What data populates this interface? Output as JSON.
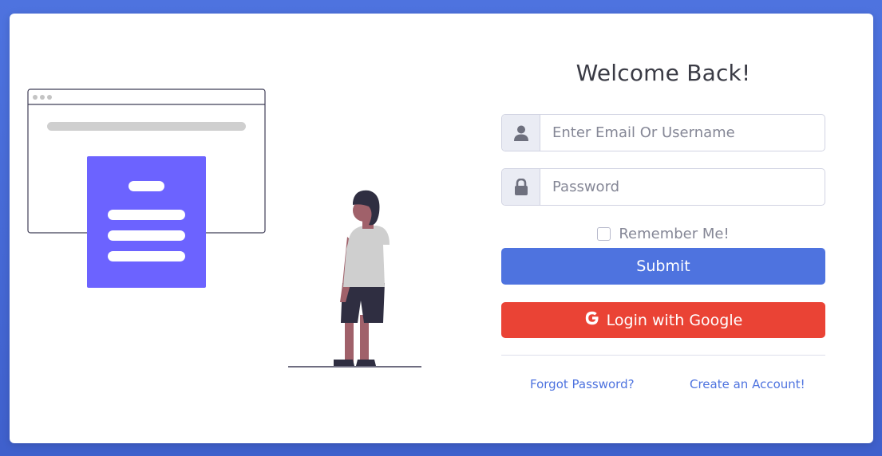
{
  "form": {
    "title": "Welcome Back!",
    "email_placeholder": "Enter Email Or Username",
    "password_placeholder": "Password",
    "remember_label": "Remember Me!",
    "submit_label": "Submit",
    "google_label": "Login with Google",
    "forgot_label": "Forgot Password?",
    "create_label": "Create an Account!"
  },
  "icons": {
    "user": "user-icon",
    "lock": "lock-icon",
    "google": "google-icon"
  },
  "colors": {
    "primary": "#4e73df",
    "google": "#ea4335",
    "illustration_accent": "#6c63ff"
  }
}
